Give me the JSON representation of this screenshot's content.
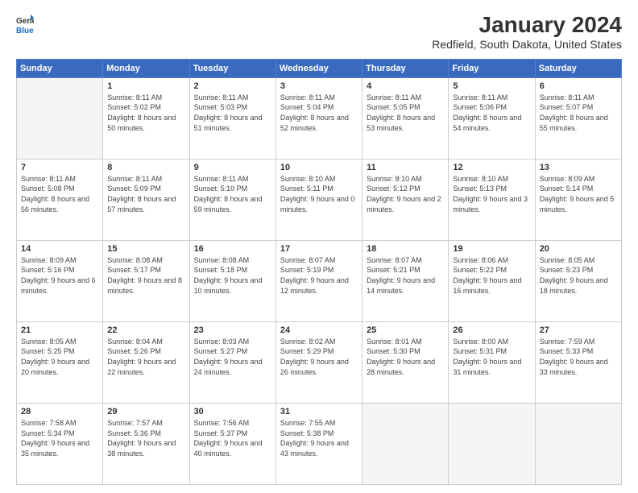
{
  "logo": {
    "line1": "General",
    "line2": "Blue"
  },
  "title": "January 2024",
  "subtitle": "Redfield, South Dakota, United States",
  "columns": [
    "Sunday",
    "Monday",
    "Tuesday",
    "Wednesday",
    "Thursday",
    "Friday",
    "Saturday"
  ],
  "weeks": [
    [
      {
        "day": "",
        "sunrise": "",
        "sunset": "",
        "daylight": ""
      },
      {
        "day": "1",
        "sunrise": "Sunrise: 8:11 AM",
        "sunset": "Sunset: 5:02 PM",
        "daylight": "Daylight: 8 hours and 50 minutes."
      },
      {
        "day": "2",
        "sunrise": "Sunrise: 8:11 AM",
        "sunset": "Sunset: 5:03 PM",
        "daylight": "Daylight: 8 hours and 51 minutes."
      },
      {
        "day": "3",
        "sunrise": "Sunrise: 8:11 AM",
        "sunset": "Sunset: 5:04 PM",
        "daylight": "Daylight: 8 hours and 52 minutes."
      },
      {
        "day": "4",
        "sunrise": "Sunrise: 8:11 AM",
        "sunset": "Sunset: 5:05 PM",
        "daylight": "Daylight: 8 hours and 53 minutes."
      },
      {
        "day": "5",
        "sunrise": "Sunrise: 8:11 AM",
        "sunset": "Sunset: 5:06 PM",
        "daylight": "Daylight: 8 hours and 54 minutes."
      },
      {
        "day": "6",
        "sunrise": "Sunrise: 8:11 AM",
        "sunset": "Sunset: 5:07 PM",
        "daylight": "Daylight: 8 hours and 55 minutes."
      }
    ],
    [
      {
        "day": "7",
        "sunrise": "Sunrise: 8:11 AM",
        "sunset": "Sunset: 5:08 PM",
        "daylight": "Daylight: 8 hours and 56 minutes."
      },
      {
        "day": "8",
        "sunrise": "Sunrise: 8:11 AM",
        "sunset": "Sunset: 5:09 PM",
        "daylight": "Daylight: 8 hours and 57 minutes."
      },
      {
        "day": "9",
        "sunrise": "Sunrise: 8:11 AM",
        "sunset": "Sunset: 5:10 PM",
        "daylight": "Daylight: 8 hours and 59 minutes."
      },
      {
        "day": "10",
        "sunrise": "Sunrise: 8:10 AM",
        "sunset": "Sunset: 5:11 PM",
        "daylight": "Daylight: 9 hours and 0 minutes."
      },
      {
        "day": "11",
        "sunrise": "Sunrise: 8:10 AM",
        "sunset": "Sunset: 5:12 PM",
        "daylight": "Daylight: 9 hours and 2 minutes."
      },
      {
        "day": "12",
        "sunrise": "Sunrise: 8:10 AM",
        "sunset": "Sunset: 5:13 PM",
        "daylight": "Daylight: 9 hours and 3 minutes."
      },
      {
        "day": "13",
        "sunrise": "Sunrise: 8:09 AM",
        "sunset": "Sunset: 5:14 PM",
        "daylight": "Daylight: 9 hours and 5 minutes."
      }
    ],
    [
      {
        "day": "14",
        "sunrise": "Sunrise: 8:09 AM",
        "sunset": "Sunset: 5:16 PM",
        "daylight": "Daylight: 9 hours and 6 minutes."
      },
      {
        "day": "15",
        "sunrise": "Sunrise: 8:08 AM",
        "sunset": "Sunset: 5:17 PM",
        "daylight": "Daylight: 9 hours and 8 minutes."
      },
      {
        "day": "16",
        "sunrise": "Sunrise: 8:08 AM",
        "sunset": "Sunset: 5:18 PM",
        "daylight": "Daylight: 9 hours and 10 minutes."
      },
      {
        "day": "17",
        "sunrise": "Sunrise: 8:07 AM",
        "sunset": "Sunset: 5:19 PM",
        "daylight": "Daylight: 9 hours and 12 minutes."
      },
      {
        "day": "18",
        "sunrise": "Sunrise: 8:07 AM",
        "sunset": "Sunset: 5:21 PM",
        "daylight": "Daylight: 9 hours and 14 minutes."
      },
      {
        "day": "19",
        "sunrise": "Sunrise: 8:06 AM",
        "sunset": "Sunset: 5:22 PM",
        "daylight": "Daylight: 9 hours and 16 minutes."
      },
      {
        "day": "20",
        "sunrise": "Sunrise: 8:05 AM",
        "sunset": "Sunset: 5:23 PM",
        "daylight": "Daylight: 9 hours and 18 minutes."
      }
    ],
    [
      {
        "day": "21",
        "sunrise": "Sunrise: 8:05 AM",
        "sunset": "Sunset: 5:25 PM",
        "daylight": "Daylight: 9 hours and 20 minutes."
      },
      {
        "day": "22",
        "sunrise": "Sunrise: 8:04 AM",
        "sunset": "Sunset: 5:26 PM",
        "daylight": "Daylight: 9 hours and 22 minutes."
      },
      {
        "day": "23",
        "sunrise": "Sunrise: 8:03 AM",
        "sunset": "Sunset: 5:27 PM",
        "daylight": "Daylight: 9 hours and 24 minutes."
      },
      {
        "day": "24",
        "sunrise": "Sunrise: 8:02 AM",
        "sunset": "Sunset: 5:29 PM",
        "daylight": "Daylight: 9 hours and 26 minutes."
      },
      {
        "day": "25",
        "sunrise": "Sunrise: 8:01 AM",
        "sunset": "Sunset: 5:30 PM",
        "daylight": "Daylight: 9 hours and 28 minutes."
      },
      {
        "day": "26",
        "sunrise": "Sunrise: 8:00 AM",
        "sunset": "Sunset: 5:31 PM",
        "daylight": "Daylight: 9 hours and 31 minutes."
      },
      {
        "day": "27",
        "sunrise": "Sunrise: 7:59 AM",
        "sunset": "Sunset: 5:33 PM",
        "daylight": "Daylight: 9 hours and 33 minutes."
      }
    ],
    [
      {
        "day": "28",
        "sunrise": "Sunrise: 7:58 AM",
        "sunset": "Sunset: 5:34 PM",
        "daylight": "Daylight: 9 hours and 35 minutes."
      },
      {
        "day": "29",
        "sunrise": "Sunrise: 7:57 AM",
        "sunset": "Sunset: 5:36 PM",
        "daylight": "Daylight: 9 hours and 38 minutes."
      },
      {
        "day": "30",
        "sunrise": "Sunrise: 7:56 AM",
        "sunset": "Sunset: 5:37 PM",
        "daylight": "Daylight: 9 hours and 40 minutes."
      },
      {
        "day": "31",
        "sunrise": "Sunrise: 7:55 AM",
        "sunset": "Sunset: 5:38 PM",
        "daylight": "Daylight: 9 hours and 43 minutes."
      },
      {
        "day": "",
        "sunrise": "",
        "sunset": "",
        "daylight": ""
      },
      {
        "day": "",
        "sunrise": "",
        "sunset": "",
        "daylight": ""
      },
      {
        "day": "",
        "sunrise": "",
        "sunset": "",
        "daylight": ""
      }
    ]
  ]
}
